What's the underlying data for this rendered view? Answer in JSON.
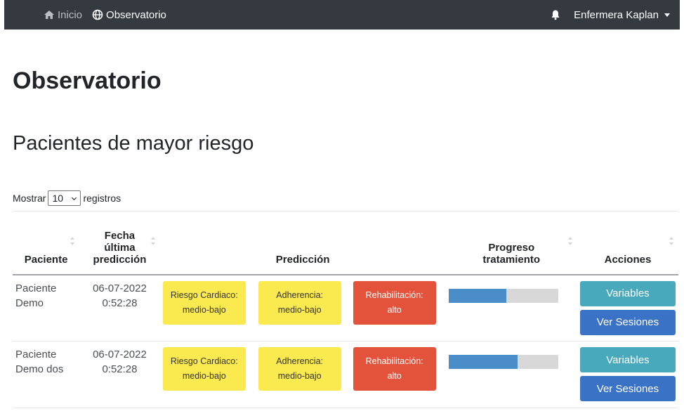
{
  "navbar": {
    "home_label": "Inicio",
    "observatorio_label": "Observatorio",
    "user_label": "Enfermera Kaplan"
  },
  "page": {
    "title": "Observatorio",
    "section_title": "Pacientes de mayor riesgo"
  },
  "length_control": {
    "prefix": "Mostrar",
    "value": "10",
    "suffix": "registros"
  },
  "table": {
    "columns": {
      "paciente": "Paciente",
      "fecha_line1": "Fecha",
      "fecha_line2": "última",
      "fecha_line3": "predicción",
      "prediccion": "Predicción",
      "progreso_line1": "Progreso",
      "progreso_line2": "tratamiento",
      "acciones": "Acciones"
    },
    "rows": [
      {
        "paciente_line1": "Paciente",
        "paciente_line2": "Demo",
        "date": "06-07-2022",
        "time": "0:52:28",
        "riesgo_label": "Riesgo Cardiaco:",
        "riesgo_value": "medio-bajo",
        "adherencia_label": "Adherencia:",
        "adherencia_value": "medio-bajo",
        "rehab_label": "Rehabilitación:",
        "rehab_value": "alto",
        "progress": 0.53,
        "variables_label": "Variables",
        "sesiones_label": "Ver Sesiones"
      },
      {
        "paciente_line1": "Paciente",
        "paciente_line2": "Demo dos",
        "date": "06-07-2022",
        "time": "0:52:28",
        "riesgo_label": "Riesgo Cardiaco:",
        "riesgo_value": "medio-bajo",
        "adherencia_label": "Adherencia:",
        "adherencia_value": "medio-bajo",
        "rehab_label": "Rehabilitación:",
        "rehab_value": "alto",
        "progress": 0.63,
        "variables_label": "Variables",
        "sesiones_label": "Ver Sesiones"
      }
    ]
  },
  "colors": {
    "navbar_bg": "#343a40",
    "badge_yellow": "#fbea4f",
    "badge_red": "#e3533c",
    "progress_fill": "#4a8dc8",
    "btn_info": "#48a9bd",
    "btn_primary": "#3a72c6"
  },
  "icons": {
    "home": "home-icon",
    "globe": "globe-icon",
    "bell": "bell-icon",
    "sort": "sort-icon"
  }
}
